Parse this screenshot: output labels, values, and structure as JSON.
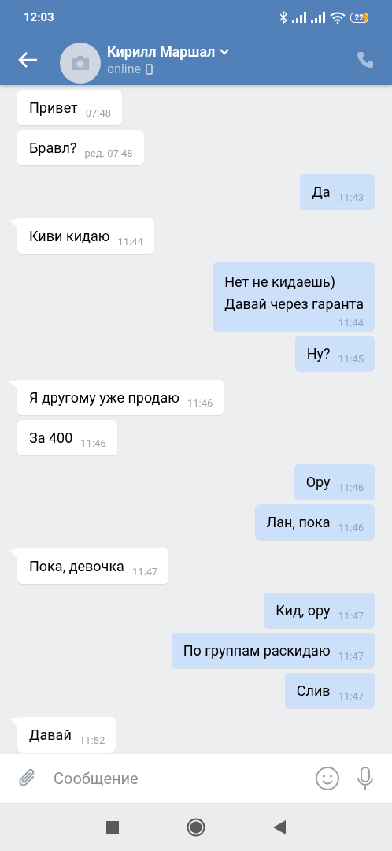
{
  "status_bar": {
    "time": "12:03",
    "battery": "22"
  },
  "header": {
    "name": "Кирилл Маршал",
    "status": "online"
  },
  "messages": [
    {
      "kind": "in",
      "tail": false,
      "text": "Привет",
      "time": "07:48"
    },
    {
      "kind": "in",
      "tail": false,
      "text": "Бравл?",
      "time": "ред. 07:48"
    },
    {
      "kind": "out",
      "tail": false,
      "text": "Да",
      "time": "11:43"
    },
    {
      "kind": "in",
      "tail": true,
      "text": "Киви кидаю",
      "time": "11:44"
    },
    {
      "kind": "out",
      "tail": false,
      "text": "Нет не кидаешь)\nДавай через гаранта",
      "time": "11:44"
    },
    {
      "kind": "out",
      "tail": false,
      "text": "Ну?",
      "time": "11:45"
    },
    {
      "kind": "in",
      "tail": true,
      "text": "Я другому уже продаю",
      "time": "11:46"
    },
    {
      "kind": "in",
      "tail": false,
      "text": "За 400",
      "time": "11:46"
    },
    {
      "kind": "out",
      "tail": false,
      "text": "Ору",
      "time": "11:46"
    },
    {
      "kind": "out",
      "tail": false,
      "text": "Лан, пока",
      "time": "11:46"
    },
    {
      "kind": "in",
      "tail": true,
      "text": "Пока, девочка",
      "time": "11:47"
    },
    {
      "kind": "out",
      "tail": false,
      "text": "Кид, ору",
      "time": "11:47"
    },
    {
      "kind": "out",
      "tail": false,
      "text": "По группам раскидаю",
      "time": "11:47"
    },
    {
      "kind": "out",
      "tail": false,
      "text": "Слив",
      "time": "11:47"
    },
    {
      "kind": "in",
      "tail": true,
      "text": "Давай",
      "time": "11:52"
    }
  ],
  "composer": {
    "placeholder": "Сообщение"
  }
}
